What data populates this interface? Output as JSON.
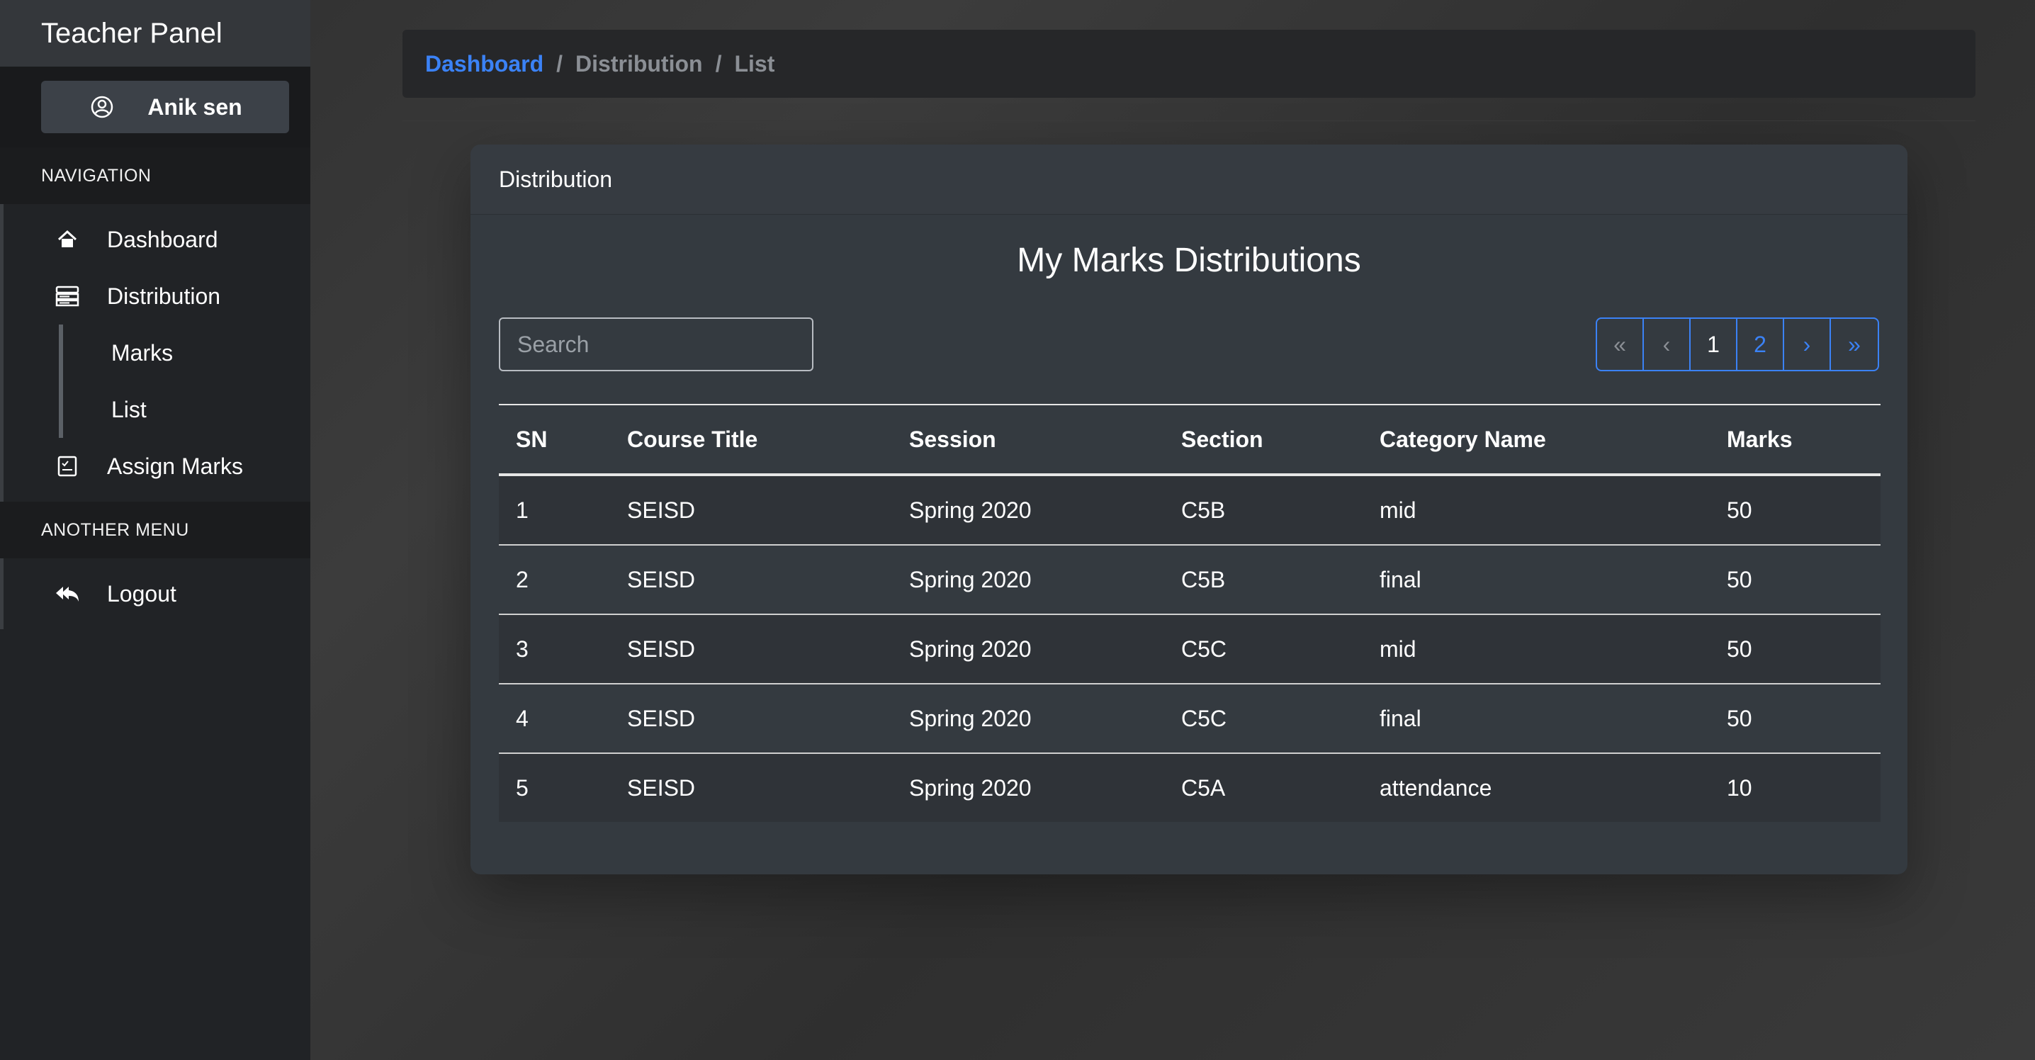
{
  "sidebar": {
    "brand": "Teacher Panel",
    "user": {
      "name": "Anik sen",
      "icon": "user-circle-icon"
    },
    "sections": [
      {
        "header": "NAVIGATION"
      },
      {
        "header": "ANOTHER MENU"
      }
    ],
    "nav": {
      "dashboard": "Dashboard",
      "distribution": "Distribution",
      "marks": "Marks",
      "list": "List",
      "assign_marks": "Assign Marks",
      "logout": "Logout"
    }
  },
  "breadcrumb": {
    "items": [
      "Dashboard",
      "Distribution",
      "List"
    ],
    "separator": "/"
  },
  "card": {
    "header": "Distribution",
    "title": "My Marks Distributions",
    "search_placeholder": "Search",
    "pagination": {
      "first": "«",
      "prev": "‹",
      "pages": [
        "1",
        "2"
      ],
      "current": "1",
      "next": "›",
      "last": "»"
    },
    "table": {
      "columns": [
        "SN",
        "Course Title",
        "Session",
        "Section",
        "Category Name",
        "Marks"
      ],
      "rows": [
        [
          "1",
          "SEISD",
          "Spring 2020",
          "C5B",
          "mid",
          "50"
        ],
        [
          "2",
          "SEISD",
          "Spring 2020",
          "C5B",
          "final",
          "50"
        ],
        [
          "3",
          "SEISD",
          "Spring 2020",
          "C5C",
          "mid",
          "50"
        ],
        [
          "4",
          "SEISD",
          "Spring 2020",
          "C5C",
          "final",
          "50"
        ],
        [
          "5",
          "SEISD",
          "Spring 2020",
          "C5A",
          "attendance",
          "10"
        ]
      ]
    }
  },
  "colors": {
    "accent": "#3b82f6",
    "sidebar_bg": "#212326",
    "card_bg": "#343a40"
  }
}
